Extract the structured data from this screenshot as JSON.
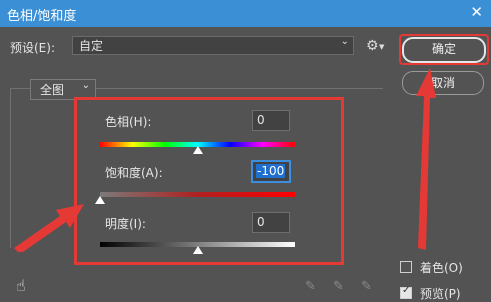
{
  "window": {
    "title": "色相/饱和度",
    "close_glyph": "✕"
  },
  "preset": {
    "label": "预设(E):",
    "value": "自定",
    "chevron": "⌄"
  },
  "buttons": {
    "ok": "确定",
    "cancel": "取消"
  },
  "range": {
    "value": "全图",
    "chevron": "⌄"
  },
  "sliders": {
    "hue": {
      "label": "色相(H):",
      "value": "0",
      "handle_level": 0.5
    },
    "saturation": {
      "label": "饱和度(A):",
      "value": "-100",
      "handle_level": 0.0
    },
    "lightness": {
      "label": "明度(I):",
      "value": "0",
      "handle_level": 0.5
    }
  },
  "options": {
    "colorize": "着色(O)",
    "preview": "预览(P)",
    "preview_checked": true,
    "colorize_checked": false
  },
  "icons": {
    "settings": "gear-icon",
    "hand": "hand-tool-icon",
    "eyedropper": "eyedropper-icon",
    "eyedropper_plus": "eyedropper-plus-icon",
    "eyedropper_minus": "eyedropper-minus-icon"
  },
  "colors": {
    "dialog_bg": "#535353",
    "title_bar": "#3a8fd5",
    "highlight": "#e53935",
    "focus": "#3d8ee0"
  }
}
